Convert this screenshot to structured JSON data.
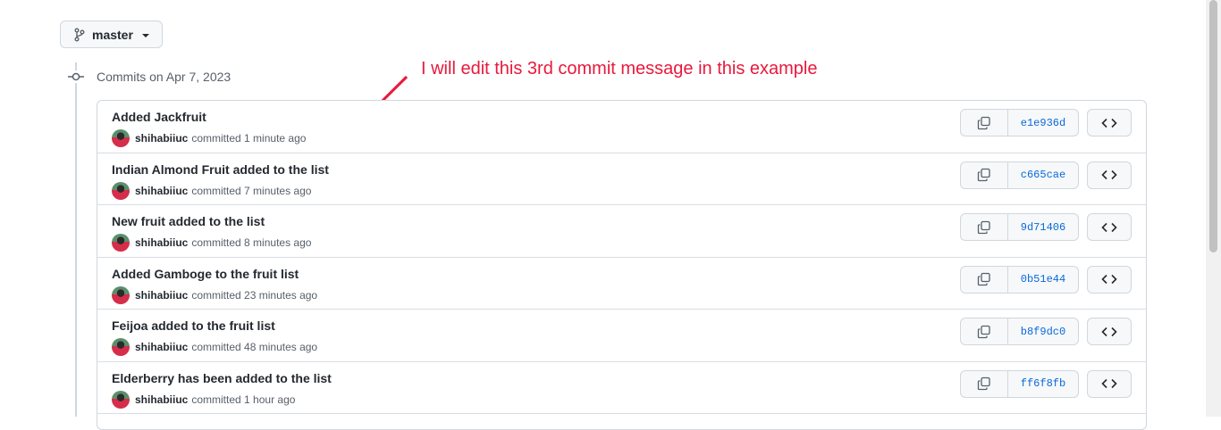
{
  "branch": {
    "name": "master"
  },
  "timeline": {
    "date_label": "Commits on Apr 7, 2023"
  },
  "annotation": {
    "text": "I will edit this 3rd commit message in this example",
    "color": "#e8193c"
  },
  "commits": [
    {
      "title": "Added Jackfruit",
      "author": "shihabiiuc",
      "action": "committed",
      "time": "1 minute ago",
      "sha": "e1e936d"
    },
    {
      "title": "Indian Almond Fruit added to the list",
      "author": "shihabiiuc",
      "action": "committed",
      "time": "7 minutes ago",
      "sha": "c665cae"
    },
    {
      "title": "New fruit added to the list",
      "author": "shihabiiuc",
      "action": "committed",
      "time": "8 minutes ago",
      "sha": "9d71406"
    },
    {
      "title": "Added Gamboge to the fruit list",
      "author": "shihabiiuc",
      "action": "committed",
      "time": "23 minutes ago",
      "sha": "0b51e44"
    },
    {
      "title": "Feijoa added to the fruit list",
      "author": "shihabiiuc",
      "action": "committed",
      "time": "48 minutes ago",
      "sha": "b8f9dc0"
    },
    {
      "title": "Elderberry has been added to the list",
      "author": "shihabiiuc",
      "action": "committed",
      "time": "1 hour ago",
      "sha": "ff6f8fb"
    }
  ],
  "colors": {
    "link": "#0969da",
    "border": "#d0d7de",
    "muted": "#57606a"
  }
}
